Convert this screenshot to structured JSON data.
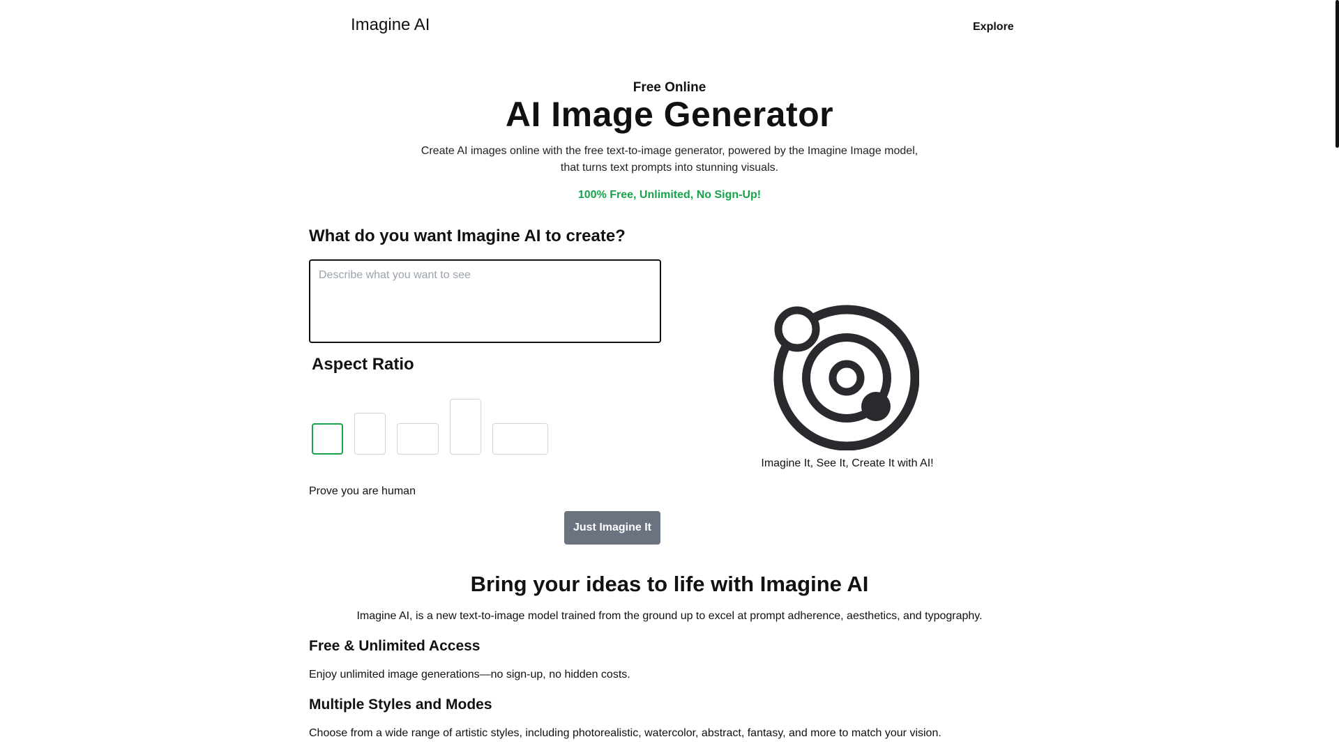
{
  "nav": {
    "brand": "Imagine AI",
    "explore": "Explore"
  },
  "hero": {
    "kicker": "Free Online",
    "title": "AI Image Generator",
    "desc_line1": "Create AI images online with the free text-to-image generator, powered by the Imagine Image model,",
    "desc_line2": "that turns text prompts into stunning visuals.",
    "badge": "100% Free, Unlimited, No Sign-Up!"
  },
  "form": {
    "heading": "What do you want Imagine AI to create?",
    "prompt_placeholder": "Describe what you want to see",
    "prompt_value": "",
    "aspect_heading": "Aspect Ratio",
    "human_text": "Prove you are human",
    "submit_label": "Just Imagine It"
  },
  "preview": {
    "icon": "orbit-logo-icon",
    "tagline": "Imagine It, See It, Create It with AI!"
  },
  "about": {
    "title": "Bring your ideas to life with Imagine AI",
    "desc": "Imagine AI, is a new text-to-image model trained from the ground up to excel at prompt adherence, aesthetics, and typography.",
    "features": [
      {
        "title": "Free & Unlimited Access",
        "text": "Enjoy unlimited image generations—no sign-up, no hidden costs."
      },
      {
        "title": "Multiple Styles and Modes",
        "text": "Choose from a wide range of artistic styles, including photorealistic, watercolor, abstract, fantasy, and more to match your vision."
      }
    ]
  },
  "colors": {
    "accent_green": "#16a34a",
    "button_gray": "#6b7280",
    "logo": "#2a2a2e"
  }
}
